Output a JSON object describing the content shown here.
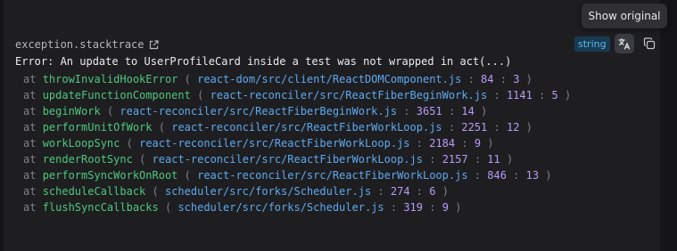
{
  "tooltip": "Show original",
  "field": {
    "name": "exception.stacktrace",
    "type": "string"
  },
  "error": "Error: An update to UserProfileCard inside a test was not wrapped in act(...)",
  "at_word": "at",
  "frames": [
    {
      "fn": "throwInvalidHookError",
      "file": "react-dom/src/client/ReactDOMComponent.js",
      "line": "84",
      "col": "3"
    },
    {
      "fn": "updateFunctionComponent",
      "file": "react-reconciler/src/ReactFiberBeginWork.js",
      "line": "1141",
      "col": "5"
    },
    {
      "fn": "beginWork",
      "file": "react-reconciler/src/ReactFiberBeginWork.js",
      "line": "3651",
      "col": "14"
    },
    {
      "fn": "performUnitOfWork",
      "file": "react-reconciler/src/ReactFiberWorkLoop.js",
      "line": "2251",
      "col": "12"
    },
    {
      "fn": "workLoopSync",
      "file": "react-reconciler/src/ReactFiberWorkLoop.js",
      "line": "2184",
      "col": "9"
    },
    {
      "fn": "renderRootSync",
      "file": "react-reconciler/src/ReactFiberWorkLoop.js",
      "line": "2157",
      "col": "11"
    },
    {
      "fn": "performSyncWorkOnRoot",
      "file": "react-reconciler/src/ReactFiberWorkLoop.js",
      "line": "846",
      "col": "13"
    },
    {
      "fn": "scheduleCallback",
      "file": "scheduler/src/forks/Scheduler.js",
      "line": "274",
      "col": "6"
    },
    {
      "fn": "flushSyncCallbacks",
      "file": "scheduler/src/forks/Scheduler.js",
      "line": "319",
      "col": "9"
    }
  ],
  "icons": {
    "open": "external-link-icon",
    "translate": "translate-icon",
    "copy": "copy-icon"
  },
  "colors": {
    "function": "#4ec77e",
    "file": "#5ea9ef",
    "number": "#b79cf5",
    "badge_bg": "#173b52",
    "badge_text": "#5cb8f0"
  }
}
